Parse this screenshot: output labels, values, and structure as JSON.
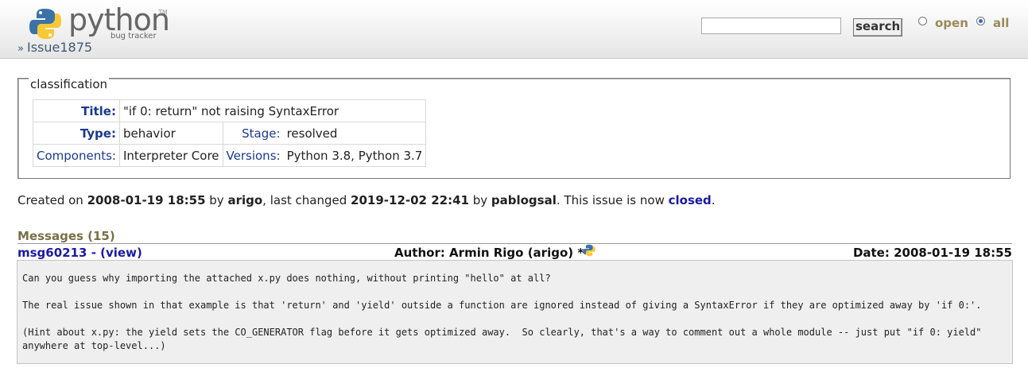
{
  "header": {
    "logo_word": "python",
    "logo_tm": "TM",
    "logo_sub": "bug tracker",
    "breadcrumb_sep": "»",
    "breadcrumb_issue": "Issue1875",
    "search_value": "",
    "search_button": "search",
    "radio_open": "open",
    "radio_all": "all",
    "radio_selected": "all"
  },
  "classification": {
    "legend": "classification",
    "title_key": "Title:",
    "title_value": "\"if 0: return\" not raising SyntaxError",
    "type_key": "Type:",
    "type_value": "behavior",
    "stage_key": "Stage:",
    "stage_value": "resolved",
    "components_key": "Components:",
    "components_value": "Interpreter Core",
    "versions_key": "Versions:",
    "versions_value": "Python 3.8, Python 3.7"
  },
  "created": {
    "prefix": "Created on ",
    "created_date": "2008-01-19 18:55",
    "by1": " by ",
    "creator": "arigo",
    "mid": ", last changed ",
    "changed_date": "2019-12-02 22:41",
    "by2": " by ",
    "changer": "pablogsal",
    "status_prefix": ". This issue is now ",
    "status": "closed",
    "end": "."
  },
  "messages": {
    "heading": "Messages (15)",
    "items": [
      {
        "id": "msg60213",
        "sep": " - ",
        "view": "(view)",
        "author": "Author: Armin Rigo (arigo) *",
        "date": "Date: 2008-01-19 18:55",
        "paragraphs": [
          "Can you guess why importing the attached x.py does nothing, without printing \"hello\" at all?",
          "The real issue shown in that example is that 'return' and 'yield' outside a function are ignored instead of giving a SyntaxError if they are optimized away by 'if 0:'.",
          "(Hint about x.py: the yield sets the CO_GENERATOR flag before it gets optimized away.  So clearly, that's a way to comment out a whole module -- just put \"if 0: yield\"\nanywhere at top-level...)"
        ]
      }
    ]
  }
}
